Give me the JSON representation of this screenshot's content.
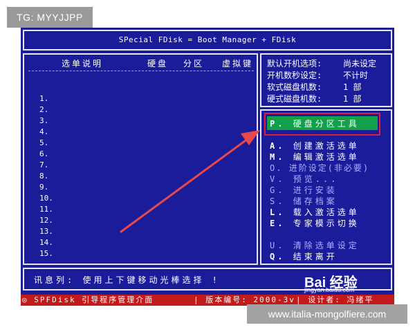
{
  "tag_label": "TG: MYYJJPP",
  "title": "SPecial FDisk = Boot Manager + FDisk",
  "left_panel": {
    "headers": [
      "选单说明",
      "硬盘",
      "分区",
      "虚拟键"
    ],
    "rows": [
      "1.",
      "2.",
      "3.",
      "4.",
      "5.",
      "6.",
      "7.",
      "8.",
      "9.",
      "10.",
      "11.",
      "12.",
      "13.",
      "14.",
      "15."
    ]
  },
  "settings": [
    {
      "label": "默认开机选项:",
      "value": "尚未设定"
    },
    {
      "label": "开机数秒设定:",
      "value": "不计时"
    },
    {
      "label": "软式磁盘机数:",
      "value": "1 部"
    },
    {
      "label": "硬式磁盘机数:",
      "value": "1 部"
    }
  ],
  "menu": [
    {
      "key": "P.",
      "text": "硬盘分区工具",
      "highlight": true
    },
    {
      "key": "A.",
      "text": "创建激活选单"
    },
    {
      "key": "M.",
      "text": "编辑激活选单"
    },
    {
      "key": "O.",
      "text": "进阶设定(非必要)",
      "dim": true
    },
    {
      "key": "V.",
      "text": "预览...",
      "dim": true
    },
    {
      "key": "G.",
      "text": "进行安装",
      "dim": true
    },
    {
      "key": "S.",
      "text": "储存档案",
      "dim": true
    },
    {
      "key": "L.",
      "text": "载入激活选单"
    },
    {
      "key": "E.",
      "text": "专家模示切换"
    },
    {
      "key": "U.",
      "text": "清除选单设定",
      "dim": true
    },
    {
      "key": "Q.",
      "text": "结束离开"
    }
  ],
  "info": "讯息列: 使用上下键移动光棒选择 !",
  "status": {
    "left": "◎ SPFDisk 引导程序管理介面",
    "middle": "| 版本编号: 2000-3v",
    "right": "| 设计者: 冯绪平"
  },
  "watermark": {
    "brand": "Bai 经验",
    "url": "jingyan.baidu.com"
  },
  "site_label": "www.italia-mongolfiere.com",
  "colors": {
    "screen": "#1b1c9a",
    "highlight": "#13a04a",
    "status": "#c21a1a",
    "annotation": "#e01e3c"
  }
}
